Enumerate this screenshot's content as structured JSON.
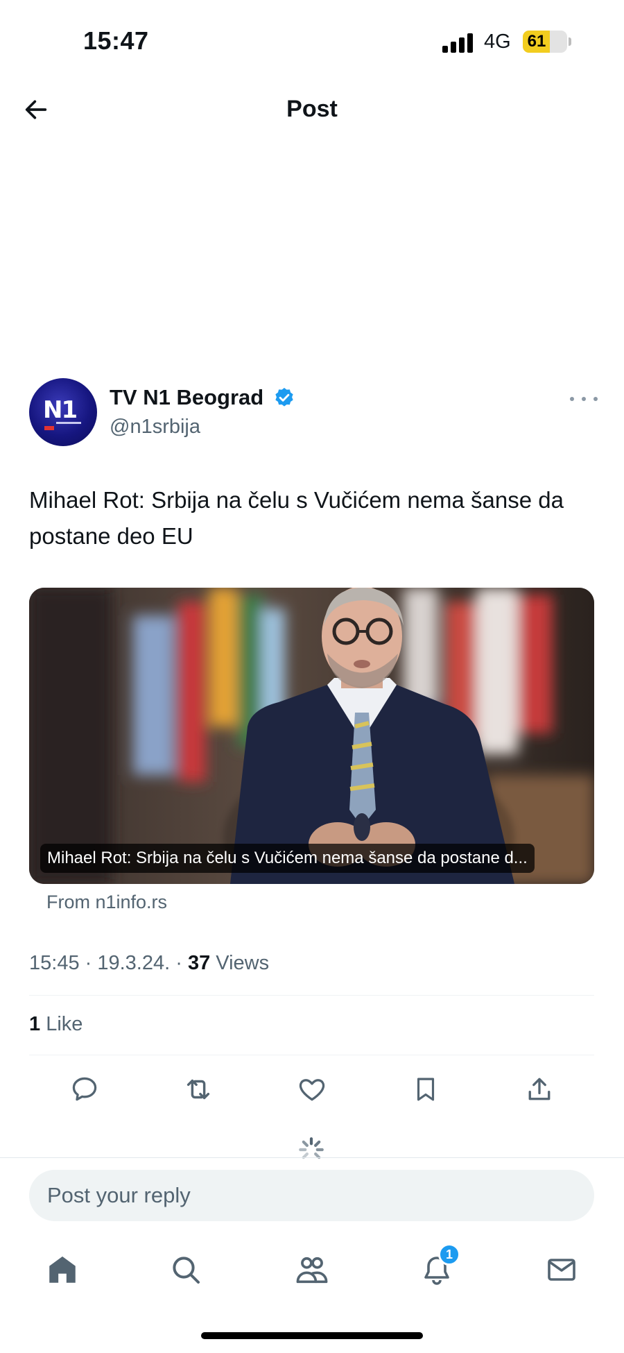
{
  "status_bar": {
    "time": "15:47",
    "network": "4G",
    "battery": "61",
    "battery_level": 0.61,
    "battery_color": "#f2cd1f"
  },
  "header": {
    "title": "Post",
    "back_icon": "arrow-left-icon"
  },
  "post": {
    "author_name": "TV N1 Beograd",
    "author_handle": "@n1srbija",
    "verified": true,
    "verified_color": "#1d9bf0",
    "avatar_logo": "N1",
    "text": "Mihael Rot: Srbija na čelu s Vučićem nema šanse da postane deo EU",
    "card": {
      "caption": "Mihael Rot: Srbija na čelu s Vučićem nema šanse da postane d...",
      "source": "From n1info.rs"
    },
    "time": "15:45",
    "date": "19.3.24.",
    "views_count": "37",
    "views_label": "Views",
    "likes_count": "1",
    "likes_label": "Like"
  },
  "actions": [
    {
      "name": "reply",
      "icon": "comment-icon"
    },
    {
      "name": "repost",
      "icon": "repost-icon"
    },
    {
      "name": "like",
      "icon": "heart-icon"
    },
    {
      "name": "bookmark",
      "icon": "bookmark-icon"
    },
    {
      "name": "share",
      "icon": "share-icon"
    }
  ],
  "reply": {
    "placeholder": "Post your reply"
  },
  "bottom_nav": {
    "items": [
      "home-icon",
      "search-icon",
      "communities-icon",
      "notifications-icon",
      "messages-icon"
    ],
    "notification_badge": "1"
  }
}
